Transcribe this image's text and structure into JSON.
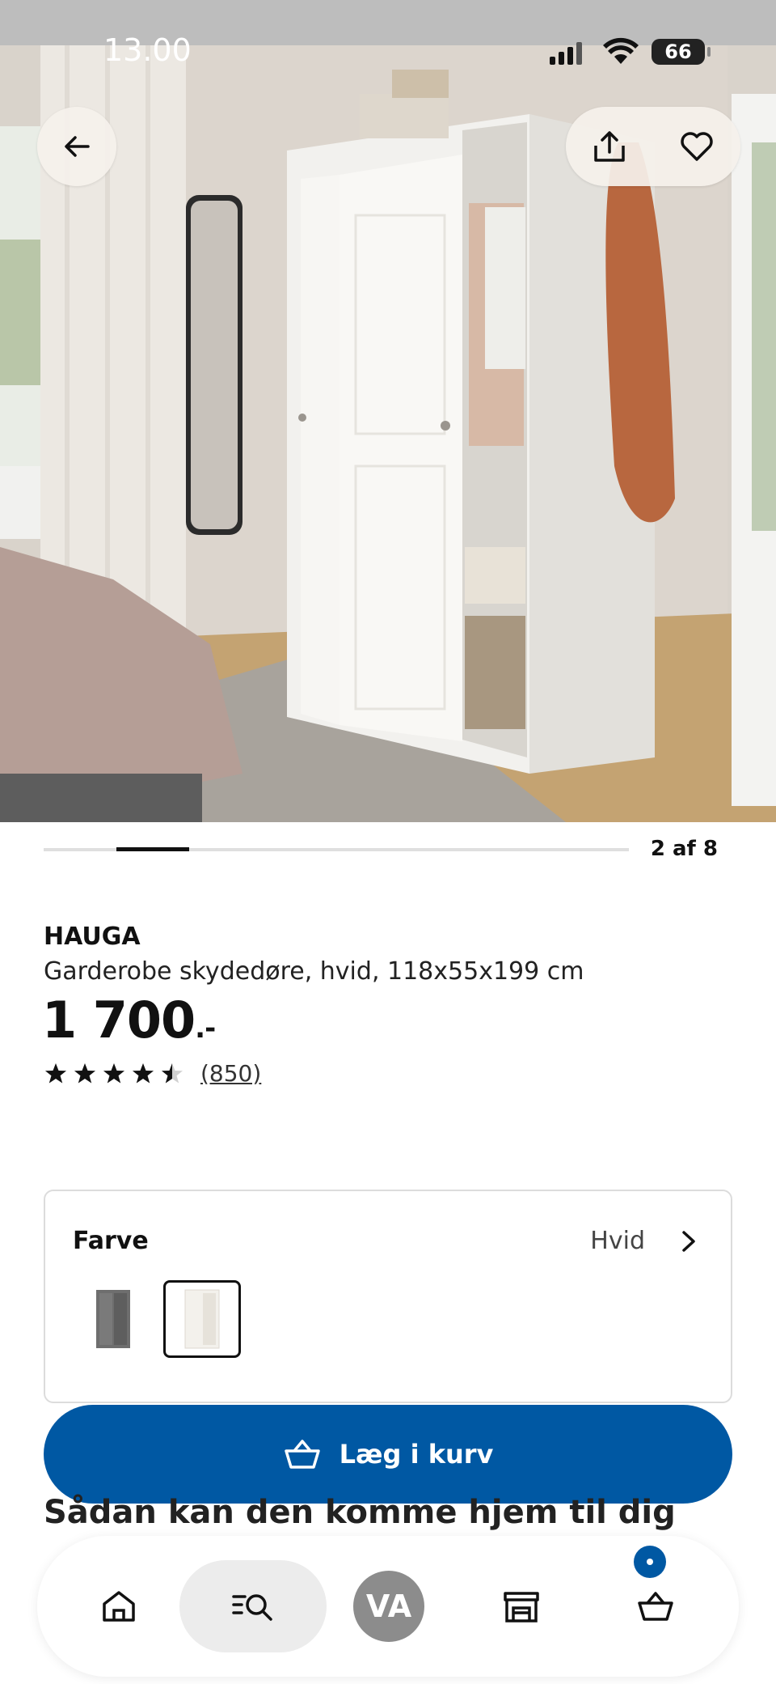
{
  "status_bar": {
    "time": "13.00",
    "battery": "66"
  },
  "gallery": {
    "counter": "2 af 8",
    "current": 2,
    "total": 8
  },
  "product": {
    "name": "HAUGA",
    "description": "Garderobe skydedøre, hvid, 118x55x199 cm",
    "price": "1 700",
    "price_suffix": ".-",
    "rating": 4.5,
    "reviews_label": "(850)"
  },
  "color_picker": {
    "title": "Farve",
    "selected_value": "Hvid",
    "swatches": [
      {
        "name": "grey",
        "color": "#6e6e6e"
      },
      {
        "name": "white",
        "color": "#f3f1ec"
      }
    ]
  },
  "add_to_cart": {
    "label": "Læg i kurv"
  },
  "delivery": {
    "title": "Sådan kan den komme hjem til dig"
  },
  "nav": {
    "avatar_initials": "VA",
    "items": [
      "home-icon",
      "search-icon",
      "avatar",
      "store-icon",
      "cart-icon"
    ],
    "active": "search-icon"
  },
  "colors": {
    "brand_blue": "#0058a3",
    "text": "#111111",
    "nav_active_bg": "#ececec"
  }
}
